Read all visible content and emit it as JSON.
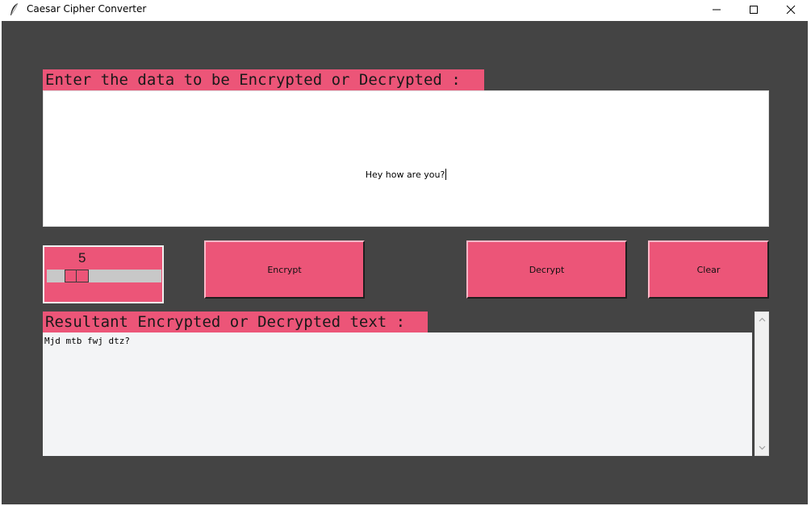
{
  "window": {
    "title": "Caesar Cipher Converter",
    "icon": "feather-icon"
  },
  "colors": {
    "background": "#444444",
    "accent": "#ec5578",
    "input_bg": "#ffffff",
    "output_bg": "#f3f4f6"
  },
  "input_section": {
    "label": "Enter the data to be Encrypted or Decrypted :",
    "value": "Hey how are you?"
  },
  "shift": {
    "value": "5",
    "position": 0.2
  },
  "buttons": {
    "encrypt": "Encrypt",
    "decrypt": "Decrypt",
    "clear": "Clear"
  },
  "output_section": {
    "label": "Resultant Encrypted or Decrypted text :",
    "value": "Mjd mtb fwj dtz?"
  }
}
